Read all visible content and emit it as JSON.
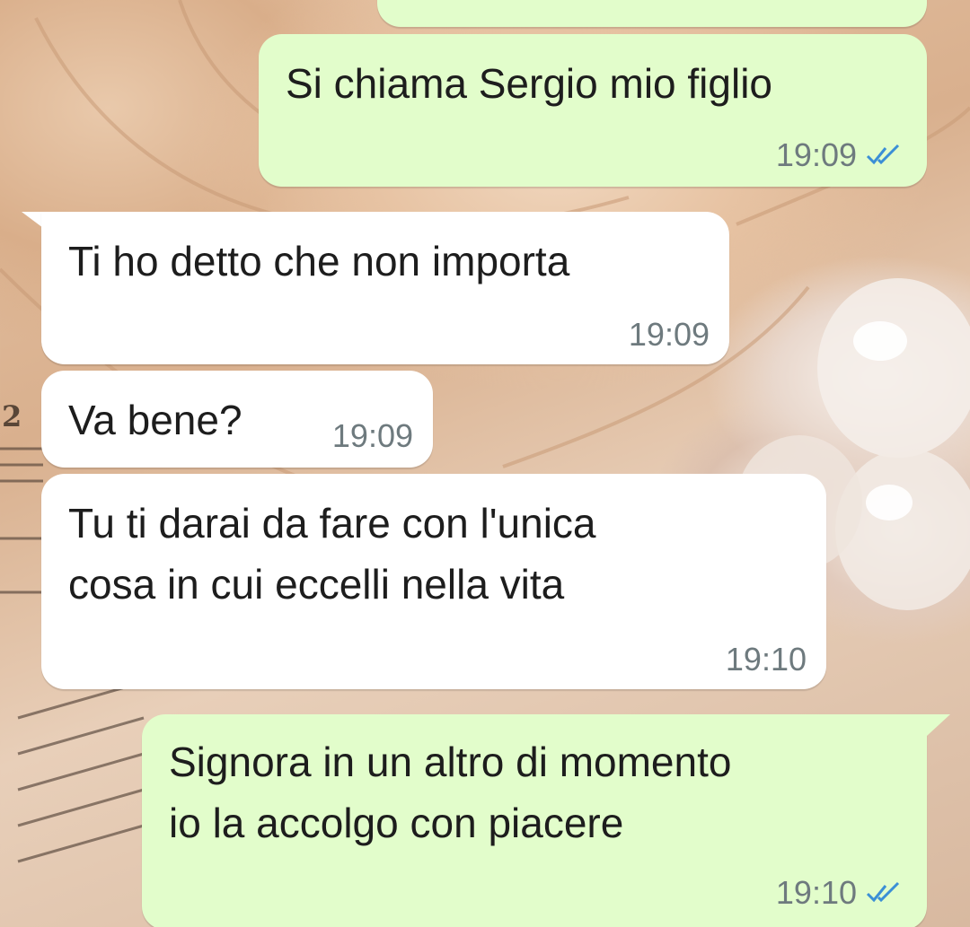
{
  "theme": {
    "incoming_bubble": "#ffffff",
    "outgoing_bubble": "#e2fdcb",
    "timestamp_color": "#6e7a7e",
    "read_ticks_color": "#3b8fd6"
  },
  "messages": [
    {
      "direction": "out",
      "text_lines": [
        "Si chiama Sergio mio figlio"
      ],
      "time": "19:09",
      "status_icon": "double-check-icon"
    },
    {
      "direction": "in",
      "text_lines": [
        "Ti ho detto che non importa"
      ],
      "time": "19:09"
    },
    {
      "direction": "in",
      "text_lines": [
        "Va bene?"
      ],
      "time": "19:09"
    },
    {
      "direction": "in",
      "text_lines": [
        "Tu ti darai da fare con l'unica",
        "cosa in cui eccelli nella vita"
      ],
      "time": "19:10"
    },
    {
      "direction": "out",
      "text_lines": [
        "Signora in un altro di momento",
        "io la accolgo con piacere"
      ],
      "time": "19:10",
      "status_icon": "double-check-icon"
    }
  ]
}
